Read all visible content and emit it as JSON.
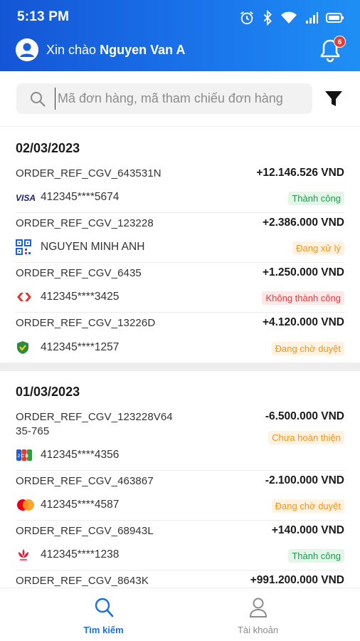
{
  "status_bar": {
    "time": "5:13 PM"
  },
  "header": {
    "greeting": "Xin chào",
    "user_name": "Nguyen Van A",
    "notification_count": "6"
  },
  "search": {
    "placeholder": "Mã đơn hàng, mã tham chiếu đơn hàng"
  },
  "groups": [
    {
      "date": "02/03/2023",
      "transactions": [
        {
          "ref": "ORDER_REF_CGV_643531N",
          "amount": "+12.146.526 VND",
          "card_icon": "visa-icon",
          "card": "412345****5674",
          "status": "Thành công",
          "status_type": "success"
        },
        {
          "ref": "ORDER_REF_CGV_123228",
          "amount": "+2.386.000 VND",
          "card_icon": "qr-code-icon",
          "card": "NGUYEN MINH ANH",
          "status": "Đang xử lý",
          "status_type": "pending"
        },
        {
          "ref": "ORDER_REF_CGV_6435",
          "amount": "+1.250.000 VND",
          "card_icon": "napas-icon",
          "card": "412345****3425",
          "status": "Không thành công",
          "status_type": "failed"
        },
        {
          "ref": "ORDER_REF_CGV_13226D",
          "amount": "+4.120.000 VND",
          "card_icon": "shield-bank-icon",
          "card": "412345****1257",
          "status": "Đang chờ duyệt",
          "status_type": "pending"
        }
      ]
    },
    {
      "date": "01/03/2023",
      "transactions": [
        {
          "ref": "ORDER_REF_CGV_123228V64 35-765",
          "amount": "-6.500.000 VND",
          "card_icon": "jcb-icon",
          "card": "412345****4356",
          "status": "Chưa hoàn thiện",
          "status_type": "pending"
        },
        {
          "ref": "ORDER_REF_CGV_463867",
          "amount": "-2.100.000 VND",
          "card_icon": "mastercard-icon",
          "card": "412345****4587",
          "status": "Đang chờ duyệt",
          "status_type": "pending"
        },
        {
          "ref": "ORDER_REF_CGV_68943L",
          "amount": "+140.000 VND",
          "card_icon": "lotus-bank-icon",
          "card": "412345****1238",
          "status": "Thành công",
          "status_type": "success"
        },
        {
          "ref": "ORDER_REF_CGV_8643K",
          "amount": "+991.200.000 VND",
          "card_icon": "card-icon",
          "card": "",
          "status": "",
          "status_type": ""
        }
      ]
    }
  ],
  "bottom_nav": [
    {
      "label": "Tìm kiếm",
      "icon": "search-icon",
      "active": true
    },
    {
      "label": "Tài khoản",
      "icon": "user-icon",
      "active": false
    }
  ],
  "colors": {
    "primary": "#1a6fe5",
    "success": "#1c9b4b",
    "pending": "#f0921c",
    "failed": "#e53a3a"
  }
}
